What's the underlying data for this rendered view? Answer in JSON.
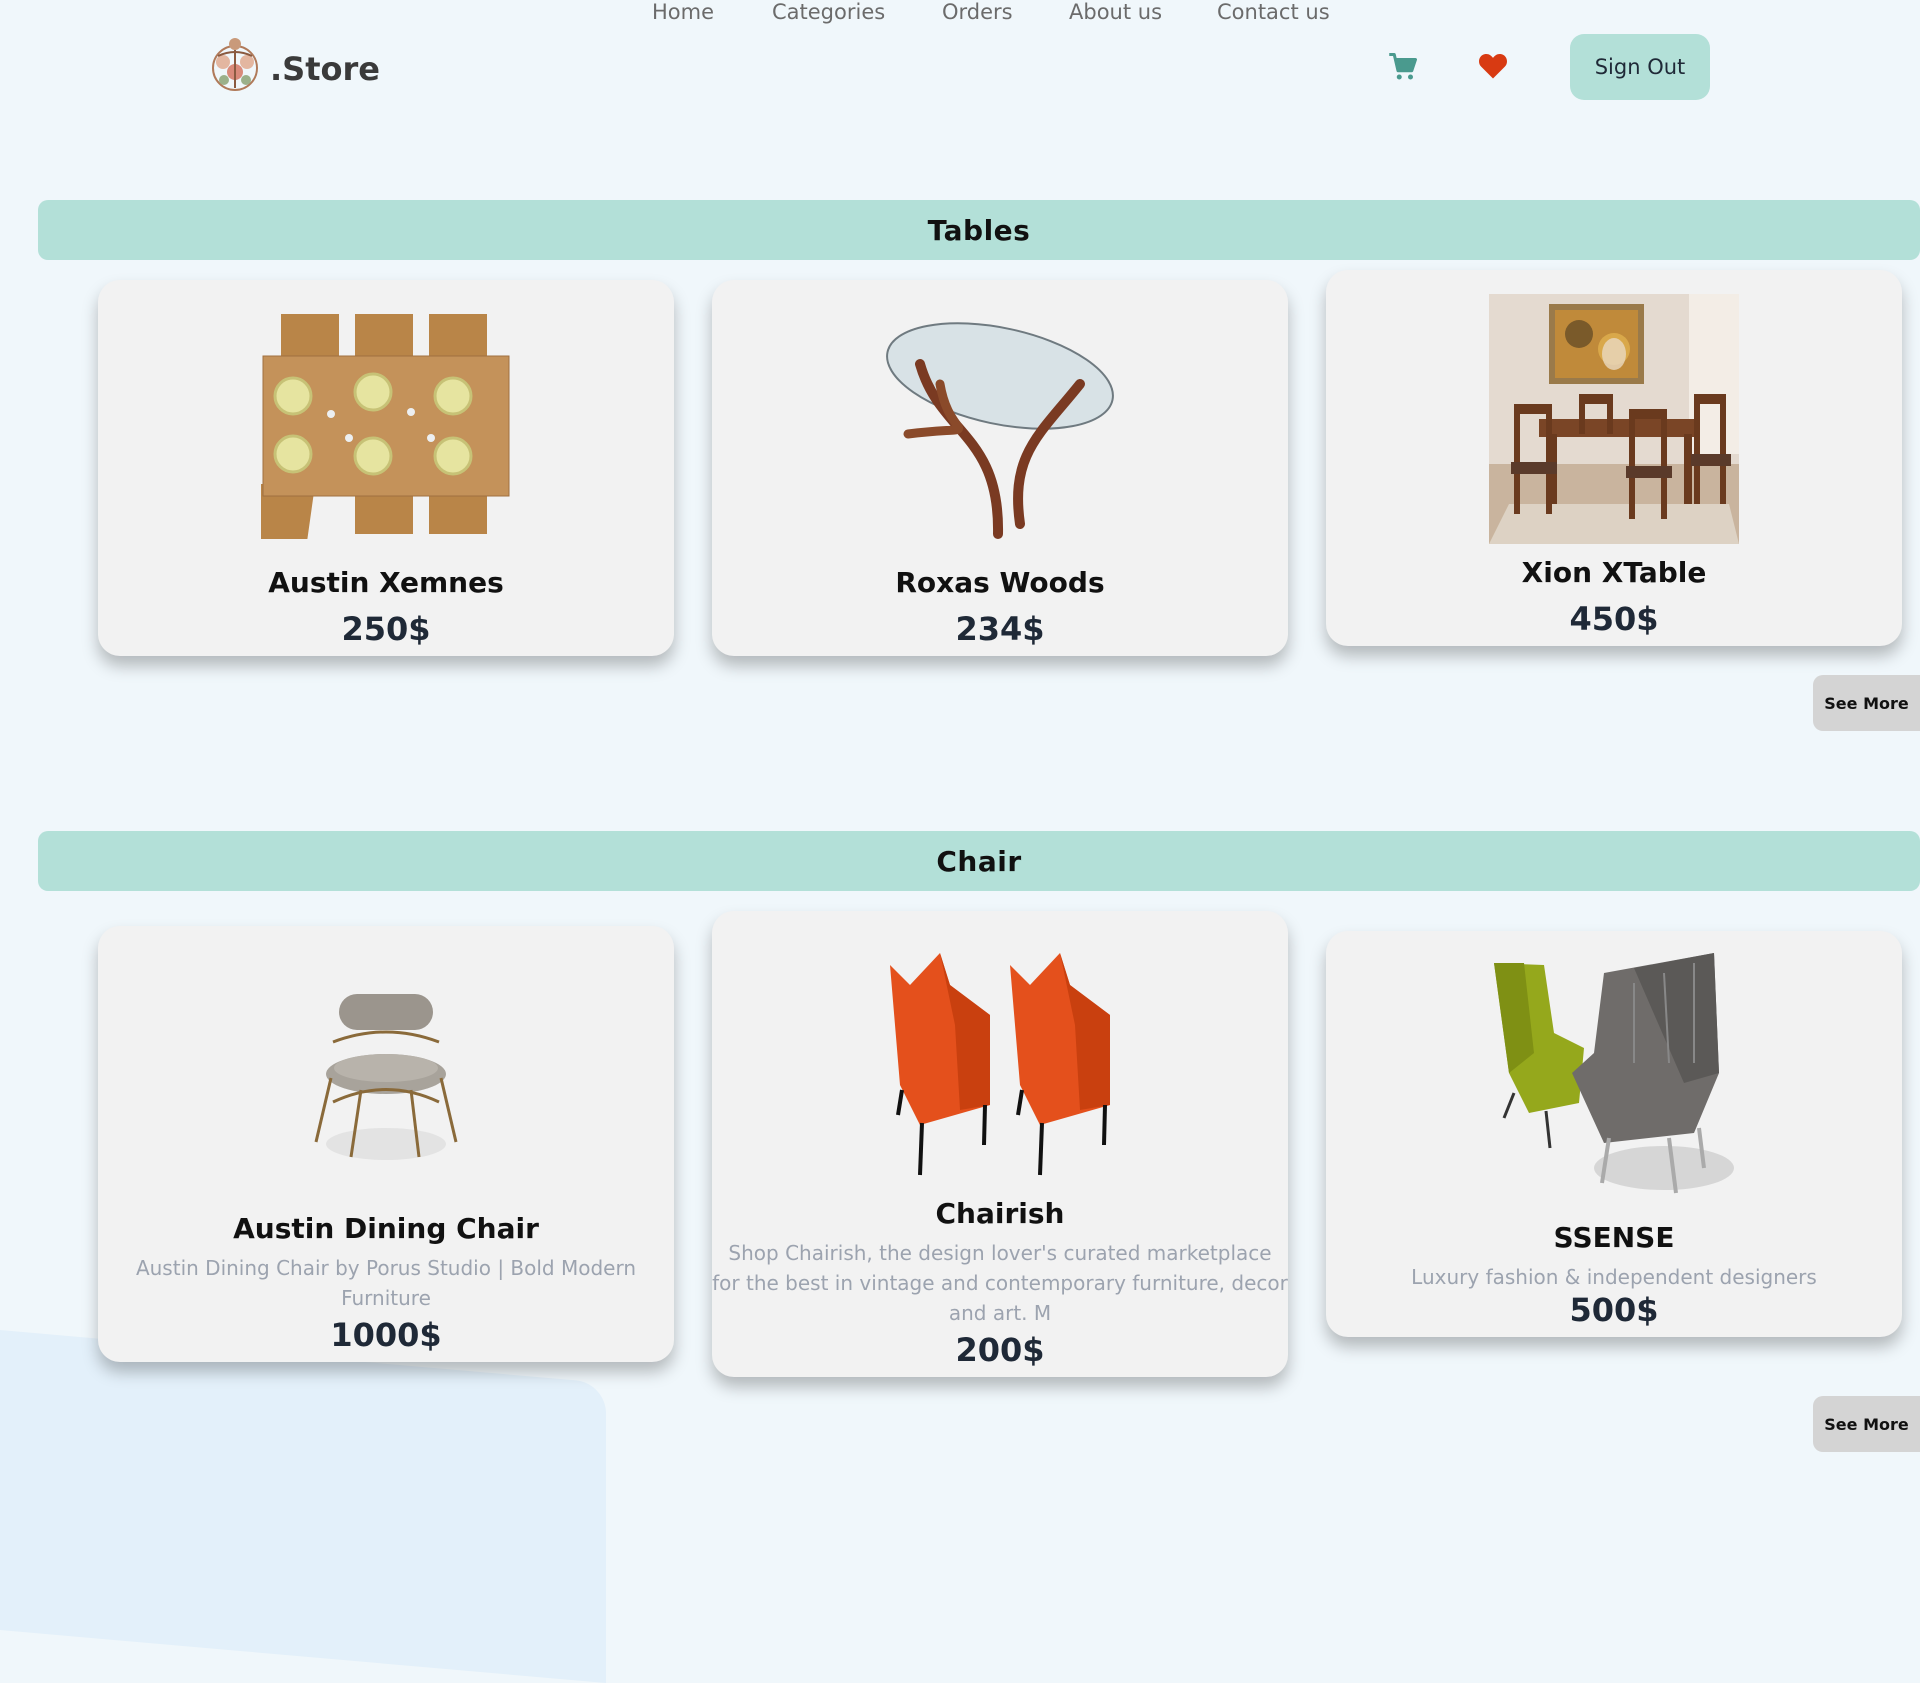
{
  "brand": {
    "name": ".Store",
    "logo_icon": "ornament-logo-icon"
  },
  "nav": {
    "links": [
      "Home",
      "Categories",
      "Orders",
      "About us",
      "Contact us"
    ],
    "cart_icon": "cart-icon",
    "heart_icon": "heart-icon",
    "sign_out": "Sign Out"
  },
  "colors": {
    "accent": "#b3e0d8",
    "cart": "#4a9a8e",
    "heart": "#d83a12",
    "page_bg": "#f0f7fb"
  },
  "sections": [
    {
      "title": "Tables",
      "see_more": "See More",
      "products": [
        {
          "name": "Austin Xemnes",
          "description": "",
          "price": "250$",
          "image": "wooden-dining-table-top-view"
        },
        {
          "name": "Roxas Woods",
          "description": "",
          "price": "234$",
          "image": "glass-top-coffee-table"
        },
        {
          "name": "Xion XTable",
          "description": "",
          "price": "450$",
          "image": "dining-room-set-photo"
        }
      ]
    },
    {
      "title": "Chair",
      "see_more": "See More",
      "products": [
        {
          "name": "Austin Dining Chair",
          "description": "Austin Dining Chair by Porus Studio | Bold Modern Furniture",
          "price": "1000$",
          "image": "round-upholstered-chair"
        },
        {
          "name": "Chairish",
          "description": "Shop Chairish, the design lover's curated marketplace for the best in vintage and contemporary furniture, decor and art. M",
          "price": "200$",
          "image": "orange-wingback-chairs"
        },
        {
          "name": "SSENSE",
          "description": "Luxury fashion & independent designers",
          "price": "500$",
          "image": "green-and-grey-armchairs"
        }
      ]
    }
  ]
}
